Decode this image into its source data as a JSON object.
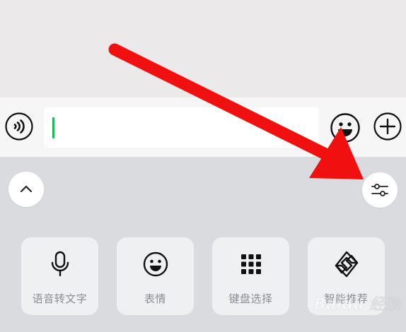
{
  "input": {
    "value": "",
    "placeholder": ""
  },
  "tools": [
    {
      "label": "语音转文字",
      "icon": "microphone-icon"
    },
    {
      "label": "表情",
      "icon": "smiley-icon"
    },
    {
      "label": "键盘选择",
      "icon": "keypad-grid-icon"
    },
    {
      "label": "智能推荐",
      "icon": "diamond-layers-icon"
    }
  ],
  "watermark": {
    "text": "Baidu 经验"
  },
  "colors": {
    "arrow": "#f01010",
    "cursor": "#1db954",
    "panel_background": "#d9dbde",
    "input_bar_background": "#f6f6f6"
  }
}
